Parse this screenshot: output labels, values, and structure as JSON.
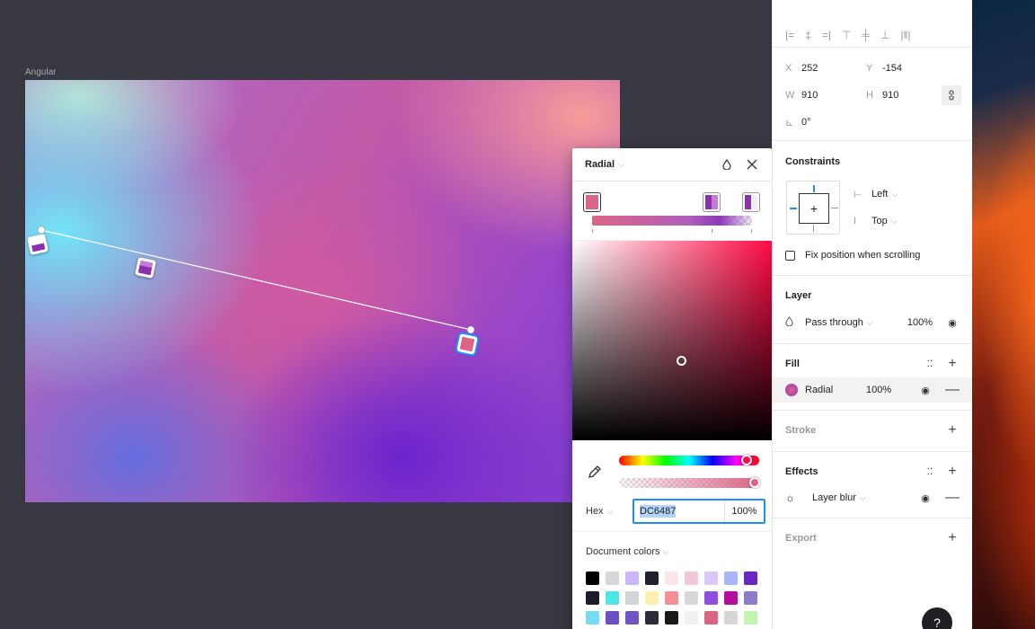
{
  "canvas": {
    "frame_label": "Angular"
  },
  "picker": {
    "type_label": "Radial",
    "hex_label": "Hex",
    "hex_value": "DC6487",
    "alpha_value": "100%",
    "doc_colors_label": "Document colors",
    "swatches": [
      "#000000",
      "#d8d8d8",
      "#c9b8f5",
      "#22202e",
      "#fbe7e9",
      "#f4c6da",
      "#d9c9f7",
      "#a7b6f5",
      "#6a27c2",
      "#1c1c2a",
      "#4fe6e6",
      "#d4d4d8",
      "#fdf0b2",
      "#f58f95",
      "#d8d8d8",
      "#8e4fe0",
      "#b30f9c",
      "#8c7cc9",
      "#76dcf2",
      "#6d4fbf",
      "#6f56c4",
      "#2c2c3a",
      "#1a1a1a",
      "#f0f0f0",
      "#dc6487",
      "#d6d6d6",
      "#c2f5b0"
    ]
  },
  "props": {
    "x_label": "X",
    "x_value": "252",
    "y_label": "Y",
    "y_value": "-154",
    "w_label": "W",
    "w_value": "910",
    "h_label": "H",
    "h_value": "910",
    "rotation": "0°",
    "constraints_title": "Constraints",
    "h_constraint": "Left",
    "v_constraint": "Top",
    "fix_position": "Fix position when scrolling",
    "layer_title": "Layer",
    "blend_mode": "Pass through",
    "layer_opacity": "100%",
    "fill_title": "Fill",
    "fill_type": "Radial",
    "fill_opacity": "100%",
    "stroke_title": "Stroke",
    "effects_title": "Effects",
    "effect_name": "Layer blur",
    "export_title": "Export",
    "help": "?"
  }
}
